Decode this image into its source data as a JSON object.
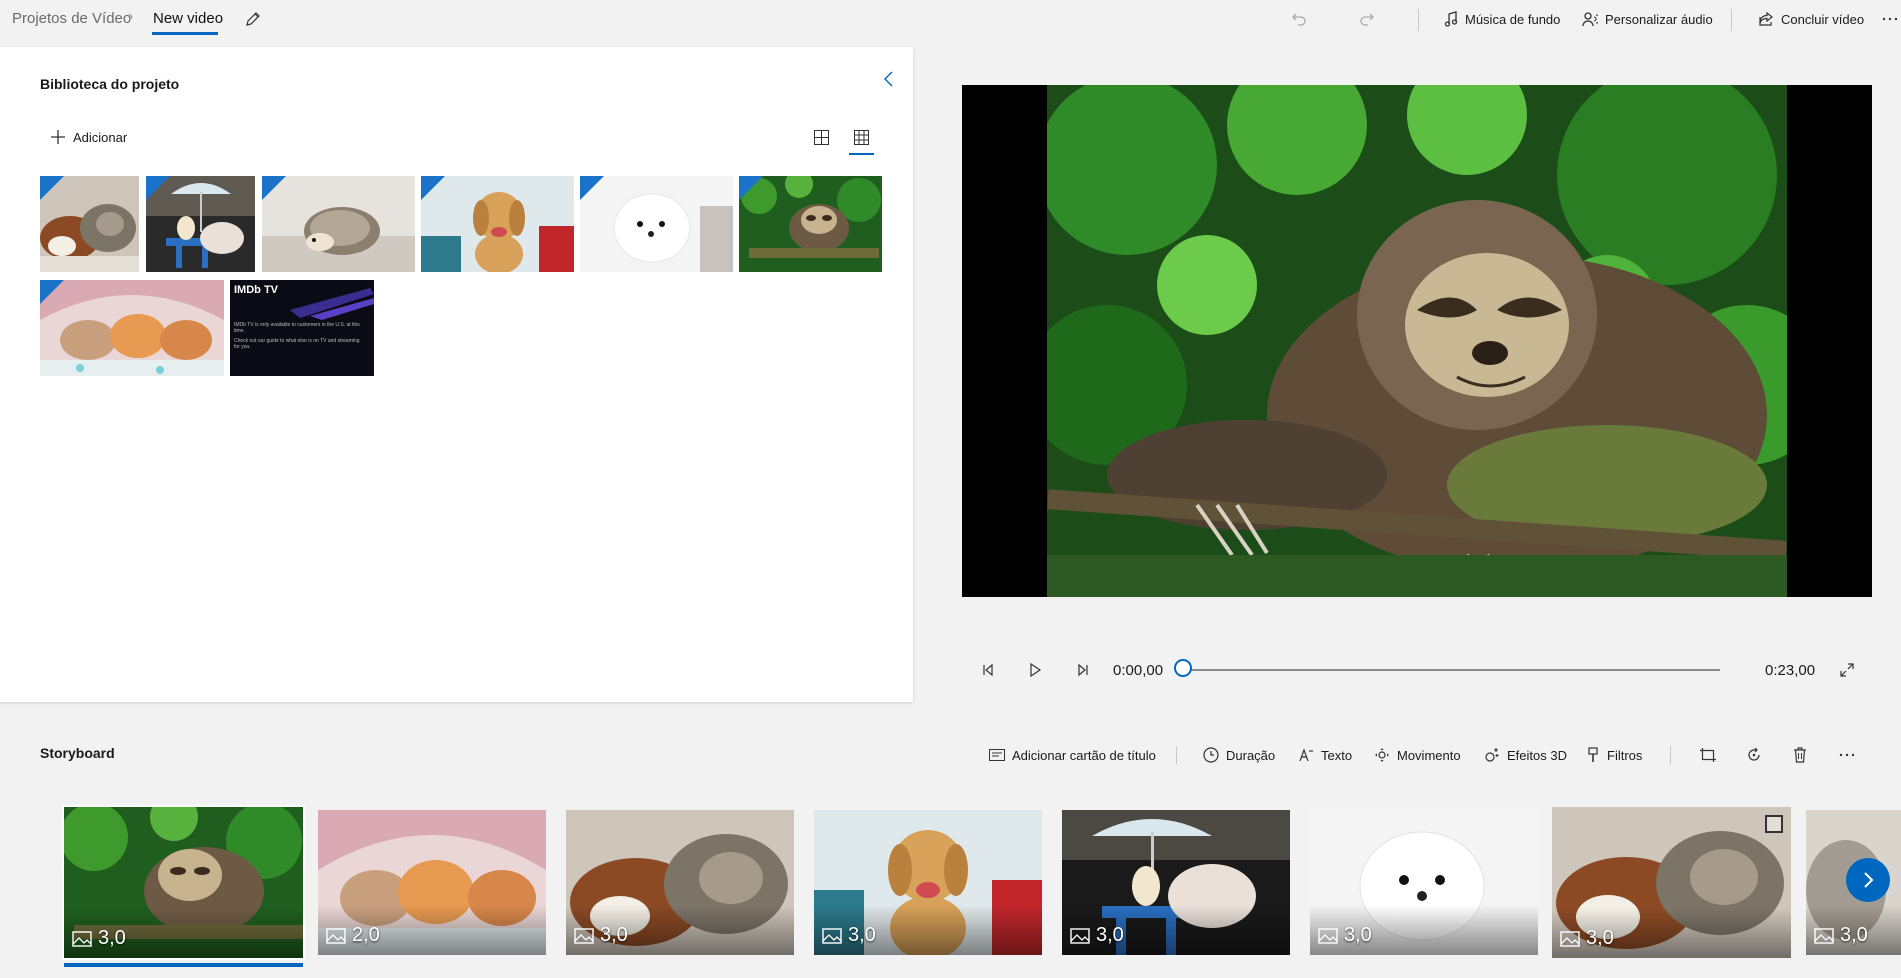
{
  "breadcrumb": {
    "parent": "Projetos de Vídeo",
    "current": "New video"
  },
  "toolbar": {
    "background_music": "Música de fundo",
    "custom_audio": "Personalizar áudio",
    "finish_video": "Concluir vídeo",
    "icons": [
      "edit-icon",
      "undo-icon",
      "redo-icon",
      "music-note-icon",
      "person-audio-icon",
      "share-icon",
      "more-icon"
    ]
  },
  "library": {
    "title": "Biblioteca do projeto",
    "add_label": "Adicionar",
    "items": [
      {
        "subject": "guinea-pig-and-cat"
      },
      {
        "subject": "piglet-with-umbrella"
      },
      {
        "subject": "hedgehog"
      },
      {
        "subject": "golden-puppy"
      },
      {
        "subject": "white-pomeranian"
      },
      {
        "subject": "sloth"
      },
      {
        "subject": "kittens"
      },
      {
        "subject": "imdb-tv-screenshot",
        "logo_text": "IMDb TV",
        "lines": [
          "IMDb TV is only available to customers in the U.S. at this time.",
          "Check out our guide to what else is on TV and streaming for you."
        ]
      }
    ]
  },
  "player": {
    "current_time": "0:00,00",
    "total_time": "0:23,00",
    "progress": 0.0
  },
  "storyboard": {
    "title": "Storyboard",
    "tools": {
      "add_title_card": "Adicionar cartão de título",
      "duration": "Duração",
      "text": "Texto",
      "motion": "Movimento",
      "effects_3d": "Efeitos 3D",
      "filters": "Filtros"
    },
    "clips": [
      {
        "subject": "sloth",
        "duration": "3,0",
        "selected": true
      },
      {
        "subject": "kittens",
        "duration": "2,0"
      },
      {
        "subject": "guinea-pig-and-cat",
        "duration": "3,0"
      },
      {
        "subject": "golden-puppy",
        "duration": "3,0"
      },
      {
        "subject": "piglet-with-umbrella",
        "duration": "3,0"
      },
      {
        "subject": "white-pomeranian",
        "duration": "3,0"
      },
      {
        "subject": "guinea-pig-and-cat",
        "duration": "3,0"
      },
      {
        "subject": "partial",
        "duration": "3,0"
      }
    ]
  },
  "colors": {
    "accent": "#0067c0",
    "corner_marker": "#1a73c8"
  }
}
